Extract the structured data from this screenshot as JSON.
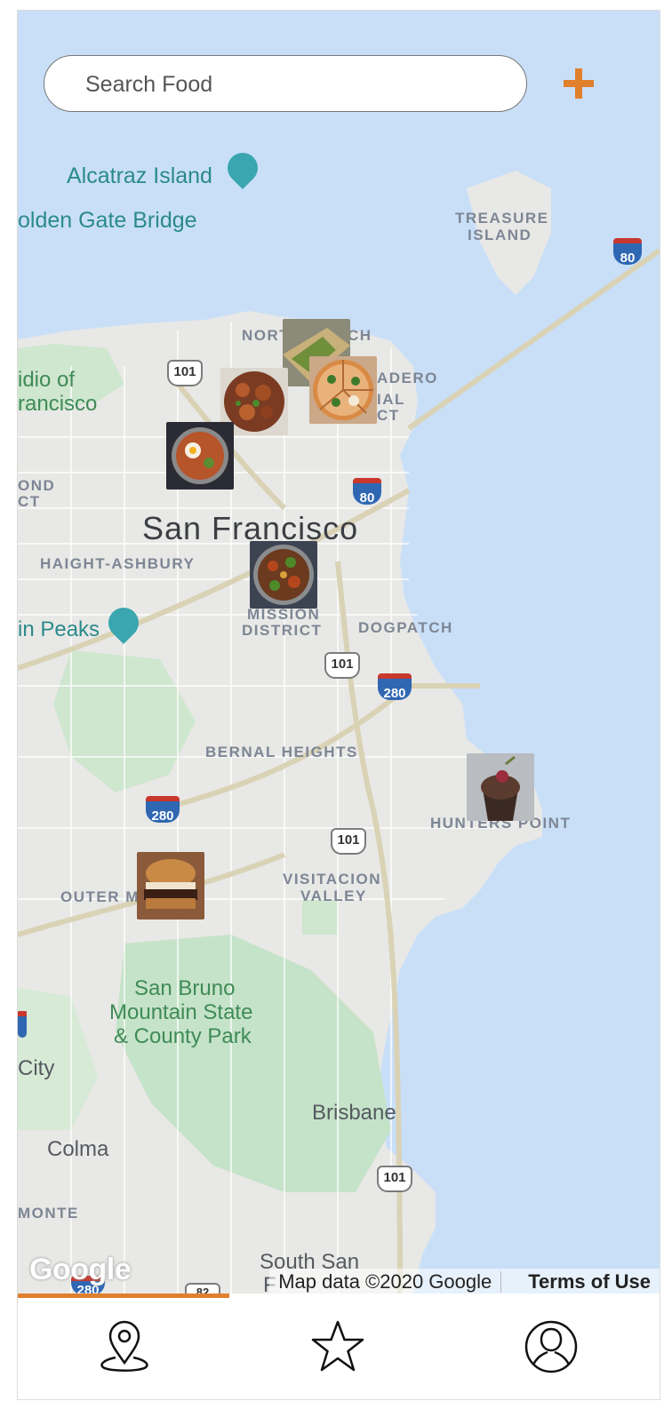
{
  "search": {
    "placeholder": "Search Food",
    "value": ""
  },
  "add_button": {
    "icon": "plus-icon",
    "color": "#E07F2C"
  },
  "map": {
    "labels": {
      "alcatraz": "Alcatraz Island",
      "golden_gate": "olden Gate Bridge",
      "treasure_1": "TREASURE",
      "treasure_2": "ISLAND",
      "north_beach": "NORT",
      "north_beach_end": "CH",
      "presidio_1": "idio of",
      "presidio_2": "rancisco",
      "embarcadero_1": "ADERO",
      "embarcadero_2": "IAL",
      "embarcadero_3": "CT",
      "richmond_1": "OND",
      "richmond_2": "CT",
      "san_francisco": "San Francisco",
      "haight": "HAIGHT-ASHBURY",
      "twin_peaks": "in Peaks",
      "mission_1": "MISSION",
      "mission_2": "DISTRICT",
      "dogpatch": "DOGPATCH",
      "bernal": "BERNAL HEIGHTS",
      "hunters_point": "HUNTERS POINT",
      "outer_mission": "OUTER M",
      "visitacion_1": "VISITACION",
      "visitacion_2": "VALLEY",
      "san_bruno_1": "San Bruno",
      "san_bruno_2": "Mountain State",
      "san_bruno_3": "& County Park",
      "city": "City",
      "brisbane": "Brisbane",
      "colma": "Colma",
      "monte": "MONTE",
      "south_san": "South San",
      "south_san_2": "F"
    },
    "shields": [
      "101",
      "101",
      "101",
      "101",
      "101",
      "82"
    ],
    "interstates": [
      "80",
      "80",
      "280",
      "280",
      "280",
      "80"
    ],
    "google_logo": "Google",
    "attribution": "Map data ©2020 Google",
    "terms": "Terms of Use",
    "food_pins": [
      "sandwich",
      "chicken-dish",
      "pizza",
      "ramen",
      "stir-fry",
      "cupcake",
      "burger"
    ]
  },
  "tabs": [
    {
      "name": "map",
      "icon": "map-pin-icon",
      "active": true
    },
    {
      "name": "favorites",
      "icon": "star-icon",
      "active": false
    },
    {
      "name": "profile",
      "icon": "user-icon",
      "active": false
    }
  ],
  "colors": {
    "water": "#C9DFF8",
    "land": "#E8E8E6",
    "park": "#C5E3C8",
    "accent": "#E07F2C"
  }
}
